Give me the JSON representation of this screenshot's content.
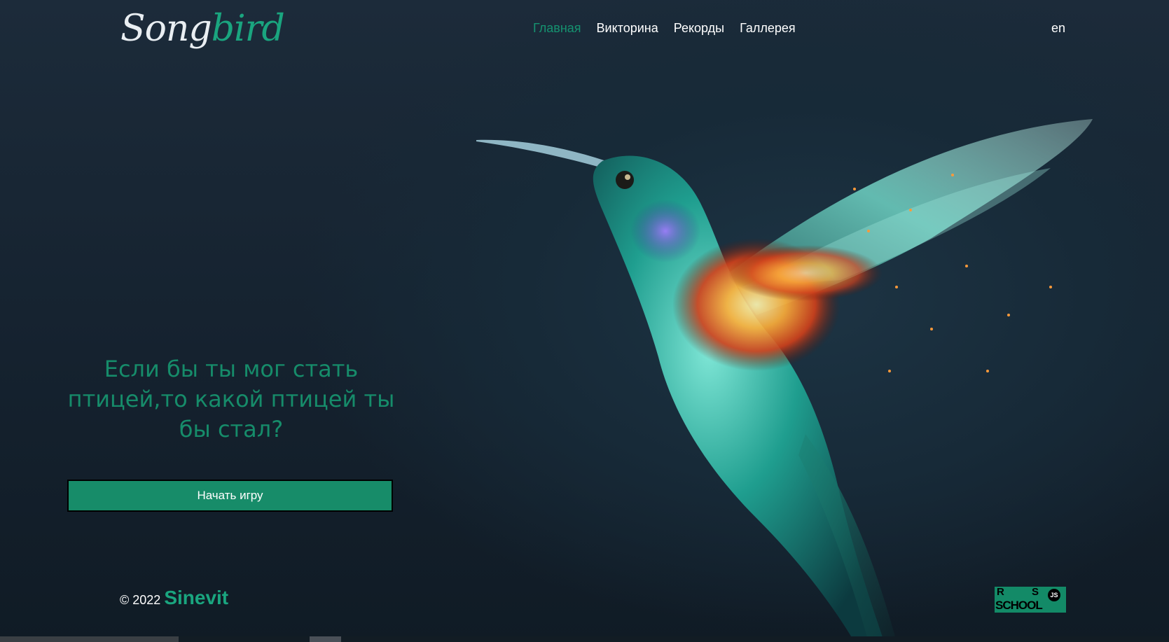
{
  "header": {
    "logo_part1": "Song",
    "logo_part2": "bird",
    "nav": [
      {
        "label": "Главная",
        "active": true
      },
      {
        "label": "Викторина",
        "active": false
      },
      {
        "label": "Рекорды",
        "active": false
      },
      {
        "label": "Галлерея",
        "active": false
      }
    ],
    "lang": "en"
  },
  "hero": {
    "title": "Если бы ты мог стать птицей,то какой птицей ты бы стал?",
    "start_button": "Начать игру"
  },
  "footer": {
    "copyright": "© 2022",
    "author": "Sinevit",
    "school_logo": {
      "r": "R",
      "s": "S",
      "school": "SCHOOL",
      "js": "JS"
    }
  },
  "colors": {
    "accent": "#178c69",
    "background": "#16222e",
    "text": "#ffffff"
  },
  "icons": {
    "hero_image": "hummingbird-illustration",
    "school_logo": "rs-school-logo"
  }
}
